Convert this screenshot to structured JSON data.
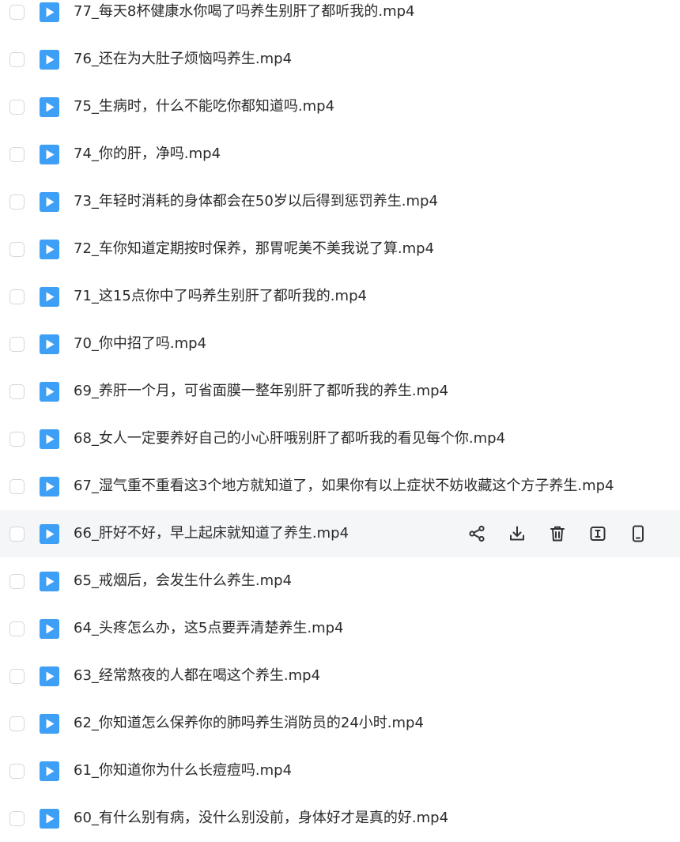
{
  "files": [
    {
      "name": "77_每天8杯健康水你喝了吗养生别肝了都听我的.mp4",
      "icon": "video-file-icon"
    },
    {
      "name": "76_还在为大肚子烦恼吗养生.mp4",
      "icon": "video-file-icon"
    },
    {
      "name": "75_生病时，什么不能吃你都知道吗.mp4",
      "icon": "video-file-icon"
    },
    {
      "name": "74_你的肝，净吗.mp4",
      "icon": "video-file-icon"
    },
    {
      "name": "73_年轻时消耗的身体都会在50岁以后得到惩罚养生.mp4",
      "icon": "video-file-icon"
    },
    {
      "name": "72_车你知道定期按时保养，那胃呢美不美我说了算.mp4",
      "icon": "video-file-icon"
    },
    {
      "name": "71_这15点你中了吗养生别肝了都听我的.mp4",
      "icon": "video-file-icon"
    },
    {
      "name": "70_你中招了吗.mp4",
      "icon": "video-file-icon"
    },
    {
      "name": "69_养肝一个月，可省面膜一整年别肝了都听我的养生.mp4",
      "icon": "video-file-icon"
    },
    {
      "name": "68_女人一定要养好自己的小心肝哦别肝了都听我的看见每个你.mp4",
      "icon": "video-file-icon"
    },
    {
      "name": "67_湿气重不重看这3个地方就知道了，如果你有以上症状不妨收藏这个方子养生.mp4",
      "icon": "video-file-icon"
    },
    {
      "name": "66_肝好不好，早上起床就知道了养生.mp4",
      "icon": "video-file-icon",
      "hovered": true
    },
    {
      "name": "65_戒烟后，会发生什么养生.mp4",
      "icon": "video-file-icon"
    },
    {
      "name": "64_头疼怎么办，这5点要弄清楚养生.mp4",
      "icon": "video-file-icon"
    },
    {
      "name": "63_经常熬夜的人都在喝这个养生.mp4",
      "icon": "video-file-icon"
    },
    {
      "name": "62_你知道怎么保养你的肺吗养生消防员的24小时.mp4",
      "icon": "video-file-icon"
    },
    {
      "name": "61_你知道你为什么长痘痘吗.mp4",
      "icon": "video-file-icon"
    },
    {
      "name": "60_有什么别有病，没什么别没前，身体好才是真的好.mp4",
      "icon": "video-file-icon"
    }
  ],
  "row_actions": [
    "share-icon",
    "download-icon",
    "delete-icon",
    "rename-icon",
    "phone-icon"
  ],
  "colors": {
    "file_icon": "#3d9ff5",
    "hover_row": "#f5f6f8",
    "text": "#2b2b2b",
    "checkbox_border": "#d4d6da",
    "action_icon": "#333333"
  }
}
